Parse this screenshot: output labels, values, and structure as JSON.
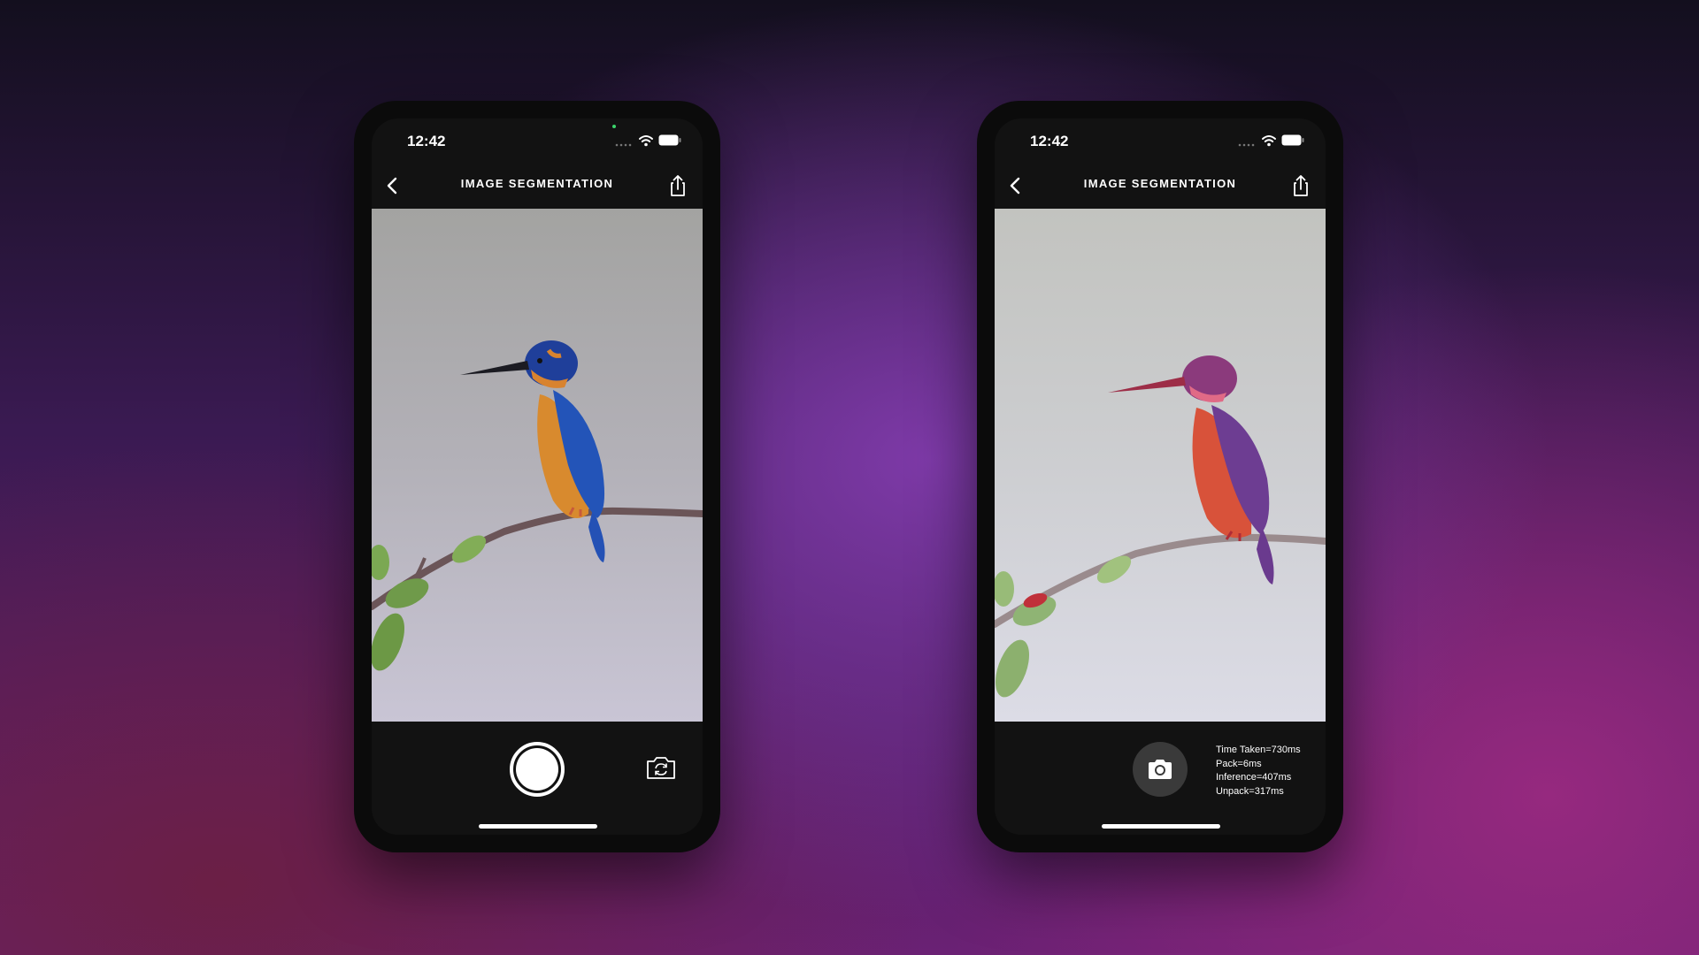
{
  "phones": [
    {
      "status_bar": {
        "time": "12:42"
      },
      "nav": {
        "title": "IMAGE SEGMENTATION"
      },
      "icons": [
        "chevron-left-icon",
        "share-icon",
        "shutter-button",
        "flip-camera-icon"
      ],
      "image": {
        "subject": "kingfisher",
        "mode": "original"
      }
    },
    {
      "status_bar": {
        "time": "12:42"
      },
      "nav": {
        "title": "IMAGE SEGMENTATION"
      },
      "icons": [
        "chevron-left-icon",
        "share-icon",
        "camera-icon"
      ],
      "image": {
        "subject": "kingfisher",
        "mode": "segmented",
        "mask_color": "#d8303a"
      },
      "metrics": [
        "Time Taken=730ms",
        "Pack=6ms",
        "Inference=407ms",
        "Unpack=317ms"
      ]
    }
  ],
  "colors": {
    "background_top": "#130f1e",
    "background_bottom": "#96297f",
    "screen_bg": "#121212",
    "text": "#ffffff"
  }
}
